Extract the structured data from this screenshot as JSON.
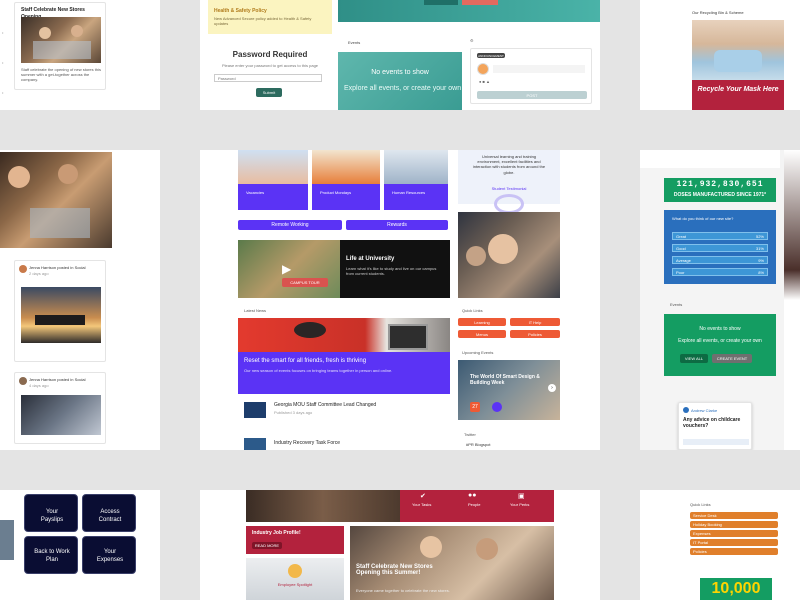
{
  "colors": {
    "purple": "#5b33f5",
    "teal": "#3aa39a",
    "green": "#149d62",
    "blue": "#2a6fbd",
    "orange": "#ee5a35",
    "crimson": "#b3223d",
    "navy": "#0a0d33",
    "amber": "#e07f2b"
  },
  "tile_top_left": {
    "title": "Staff Celebrate New Stores Opening",
    "body": "Staff celebrate the opening of new stores this summer with a get-together across the company.",
    "sidebar_marks": [
      "•",
      "•",
      "•"
    ]
  },
  "tile_top_mid": {
    "banner_title": "Health & Safety Policy",
    "banner_text": "New Advanced Secure policy added to Health & Safety updates",
    "heading": "Password Required",
    "prompt": "Please enter your password to get access to this page",
    "input_placeholder": "Password",
    "submit_label": "Submit"
  },
  "tile_top_center": {
    "events_label": "Events",
    "events_empty": "No events to show",
    "events_hint": "Explore all events, or create your own",
    "post_tag": "ANNOUNCEMENT",
    "post_button": "POST"
  },
  "tile_top_right": {
    "heading": "Our Recycling Bin & Scheme",
    "ad_title": "Recycle Your Mask Here"
  },
  "tile_mid_left": {
    "post_author": "Jenna Harrison posted in Social",
    "post_meta": "2 days ago",
    "post_author_2": "Jenna Harrison posted in Social",
    "post_meta_2": "4 days ago"
  },
  "tile_mid_center": {
    "profile_cards": [
      {
        "label": "Vacancies"
      },
      {
        "label": "Product Mondays"
      },
      {
        "label": "Human Resources"
      }
    ],
    "buttons": [
      "Remote Working",
      "Rewards"
    ],
    "video_title": "Life at University",
    "video_text": "Learn what it's like to study and live on our campus from current students.",
    "video_button": "CAMPUS TOUR",
    "quote_text": "Universal learning and training environment, excellent facilities and interaction with students from around the globe.",
    "quote_author": "Student Testimonial",
    "latest_news": "Latest News",
    "featured_title": "Reset the smart for all friends, fresh is thriving",
    "featured_text": "Our new season of events focuses on bringing teams together in person and online.",
    "news": [
      {
        "title": "Georgia MOU Staff Committee Lead Changed",
        "meta": "Published 3 days ago"
      },
      {
        "title": "Industry Recovery Task Force",
        "meta": "Published 5 days ago"
      }
    ],
    "quick_links_label": "Quick Links",
    "quick_links": [
      "Learning",
      "IT Help",
      "Menus",
      "Policies"
    ],
    "upcoming_label": "Upcoming Events",
    "event_title": "The World Of Smart Design & Building Week",
    "event_date": "27",
    "twitter_label": "Twitter",
    "twitter_handle": "#PR Blogspot"
  },
  "tile_mid_right": {
    "counter": "121,932,830,651",
    "counter_caption": "DOSES MANUFACTURED SINCE 1971*",
    "poll_question": "What do you think of our new site?",
    "poll_options": [
      {
        "label": "Great",
        "percent": "52%"
      },
      {
        "label": "Good",
        "percent": "31%"
      },
      {
        "label": "Average",
        "percent": "9%"
      },
      {
        "label": "Poor",
        "percent": "8%"
      }
    ],
    "events_label": "Events",
    "events_empty": "No events to show",
    "events_hint": "Explore all events, or create your own",
    "view_all": "VIEW ALL",
    "create_event": "CREATE EVENT",
    "question": "Any advice on childcare vouchers?",
    "question_author": "Andrew Clarke"
  },
  "tile_bottom_left": {
    "tiles": [
      "Your Payslips",
      "Access Contract",
      "Back to Work Plan",
      "Your Expenses"
    ]
  },
  "tile_bottom_mid": {
    "header_links": [
      "Your Tasks",
      "People",
      "Your Perks"
    ],
    "alert": "Industry Job Profile!",
    "alert_button": "READ MORE",
    "profile_name": "Employee Spotlight",
    "featured_title": "Staff Celebrate New Stores Opening this Summer!",
    "featured_text": "Everyone came together to celebrate the new stores."
  },
  "tile_bottom_right": {
    "heading": "Quick Links",
    "links": [
      "Service Desk",
      "Holiday Booking",
      "Expenses",
      "IT Portal",
      "Policies"
    ],
    "stat": "10,000"
  }
}
